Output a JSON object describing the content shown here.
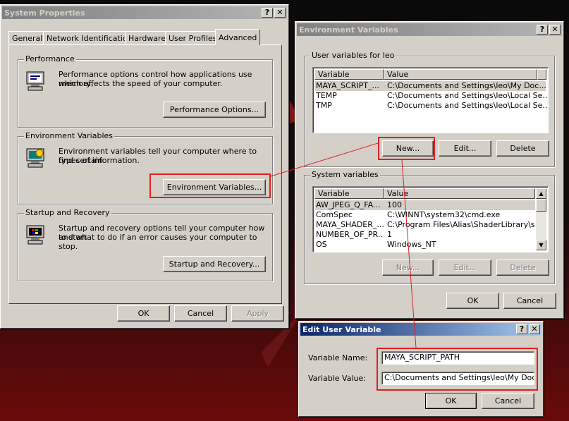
{
  "system_properties": {
    "title": "System Properties",
    "tabs": [
      {
        "label": "General"
      },
      {
        "label": "Network Identification"
      },
      {
        "label": "Hardware"
      },
      {
        "label": "User Profiles"
      },
      {
        "label": "Advanced"
      }
    ],
    "performance": {
      "group": "Performance",
      "text1": "Performance options control how applications use memory,",
      "text2": "which affects the speed of your computer.",
      "button": "Performance Options..."
    },
    "environment": {
      "group": "Environment Variables",
      "text1": "Environment variables tell your computer where to find certain",
      "text2": "types of information.",
      "button": "Environment Variables..."
    },
    "startup": {
      "group": "Startup and Recovery",
      "text1": "Startup and recovery options tell your computer how to start",
      "text2": "and what to do if an error causes your computer to stop.",
      "button": "Startup and Recovery..."
    },
    "ok": "OK",
    "cancel": "Cancel",
    "apply": "Apply"
  },
  "env_vars": {
    "title": "Environment Variables",
    "user_group": "User variables for leo",
    "col_variable": "Variable",
    "col_value": "Value",
    "user_rows": [
      {
        "name": "MAYA_SCRIPT_...",
        "value": "C:\\Documents and Settings\\leo\\My Doc..."
      },
      {
        "name": "TEMP",
        "value": "C:\\Documents and Settings\\leo\\Local Se..."
      },
      {
        "name": "TMP",
        "value": "C:\\Documents and Settings\\leo\\Local Se..."
      }
    ],
    "new": "New...",
    "edit": "Edit...",
    "delete": "Delete",
    "system_group": "System variables",
    "system_rows": [
      {
        "name": "AW_JPEG_Q_FA...",
        "value": "100"
      },
      {
        "name": "ComSpec",
        "value": "C:\\WINNT\\system32\\cmd.exe"
      },
      {
        "name": "MAYA_SHADER_...",
        "value": "C:\\Program Files\\Alias\\ShaderLibrary\\sh..."
      },
      {
        "name": "NUMBER_OF_PR...",
        "value": "1"
      },
      {
        "name": "OS",
        "value": "Windows_NT"
      }
    ],
    "sys_new": "New...",
    "sys_edit": "Edit...",
    "sys_delete": "Delete",
    "ok": "OK",
    "cancel": "Cancel"
  },
  "edit_user_var": {
    "title": "Edit User Variable",
    "name_label": "Variable Name:",
    "name_value": "MAYA_SCRIPT_PATH",
    "value_label": "Variable Value:",
    "value_value": "C:\\Documents and Settings\\leo\\My Docume",
    "ok": "OK",
    "cancel": "Cancel"
  },
  "titlebar_buttons": {
    "help": "?",
    "close": "✕"
  },
  "colors": {
    "annotation": "#e02020",
    "active_title": "#0a246a",
    "face": "#d4d0c8"
  }
}
